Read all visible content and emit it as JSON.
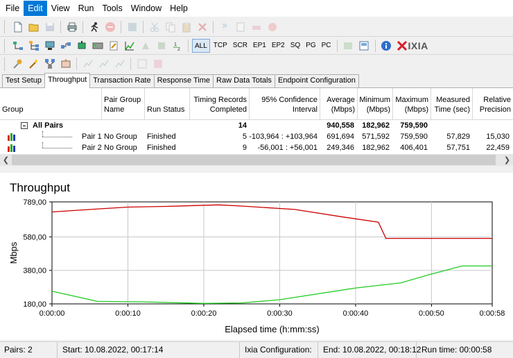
{
  "menu": {
    "items": [
      {
        "label": "File"
      },
      {
        "label": "Edit"
      },
      {
        "label": "View"
      },
      {
        "label": "Run"
      },
      {
        "label": "Tools"
      },
      {
        "label": "Window"
      },
      {
        "label": "Help"
      }
    ]
  },
  "toolbar": {
    "protocols": [
      "ALL",
      "TCP",
      "SCR",
      "EP1",
      "EP2",
      "SQ",
      "PG",
      "PC"
    ],
    "logo_text": "IXIA"
  },
  "tabs": [
    {
      "label": "Test Setup"
    },
    {
      "label": "Throughput"
    },
    {
      "label": "Transaction Rate"
    },
    {
      "label": "Response Time"
    },
    {
      "label": "Raw Data Totals"
    },
    {
      "label": "Endpoint Configuration"
    }
  ],
  "table": {
    "headers": {
      "group": "Group",
      "pair_group_1": "Pair Group",
      "pair_group_2": "Name",
      "run_status": "Run Status",
      "timing_1": "Timing Records",
      "timing_2": "Completed",
      "conf_1": "95% Confidence",
      "conf_2": "Interval",
      "avg_1": "Average",
      "avg_2": "(Mbps)",
      "min_1": "Minimum",
      "min_2": "(Mbps)",
      "max_1": "Maximum",
      "max_2": "(Mbps)",
      "meas_1": "Measured",
      "meas_2": "Time (sec)",
      "rel_1": "Relative",
      "rel_2": "Precision"
    },
    "all_pairs": {
      "label": "All Pairs",
      "records": "14",
      "average": "940,558",
      "minimum": "182,962",
      "maximum": "759,590"
    },
    "pairs": [
      {
        "label": "Pair 1",
        "pair_group": "No Group",
        "status": "Finished",
        "records": "5",
        "confidence": "-103,964 : +103,964",
        "average": "691,694",
        "minimum": "571,592",
        "maximum": "759,590",
        "measured": "57,829",
        "relative": "15,030"
      },
      {
        "label": "Pair 2",
        "pair_group": "No Group",
        "status": "Finished",
        "records": "9",
        "confidence": "-56,001 : +56,001",
        "average": "249,346",
        "minimum": "182,962",
        "maximum": "406,401",
        "measured": "57,751",
        "relative": "22,459"
      }
    ]
  },
  "chart_data": {
    "type": "line",
    "title": "Throughput",
    "xlabel": "Elapsed time (h:mm:ss)",
    "ylabel": "Mbps",
    "x_ticks": [
      "0:00:00",
      "0:00:10",
      "0:00:20",
      "0:00:30",
      "0:00:40",
      "0:00:50",
      "0:00:58"
    ],
    "y_ticks": [
      "789,00",
      "580,00",
      "380,00",
      "180,00"
    ],
    "xlim": [
      "0:00:00",
      "0:00:58"
    ],
    "ylim": [
      180,
      789
    ],
    "grid": true,
    "series": [
      {
        "color": "#cc0000",
        "points": [
          [
            "0:00:00",
            729
          ],
          [
            "0:00:05",
            744
          ],
          [
            "0:00:10",
            758
          ],
          [
            "0:00:15",
            762
          ],
          [
            "0:00:22",
            771
          ],
          [
            "0:00:25",
            764
          ],
          [
            "0:00:32",
            744
          ],
          [
            "0:00:38",
            701
          ],
          [
            "0:00:43",
            668
          ],
          [
            "0:00:44",
            571
          ],
          [
            "0:00:50",
            571
          ],
          [
            "0:00:58",
            571
          ]
        ]
      },
      {
        "color": "#22cc22",
        "points": [
          [
            "0:00:00",
            256
          ],
          [
            "0:00:06",
            195
          ],
          [
            "0:00:12",
            192
          ],
          [
            "0:00:20",
            183
          ],
          [
            "0:00:25",
            186
          ],
          [
            "0:00:30",
            205
          ],
          [
            "0:00:40",
            275
          ],
          [
            "0:00:46",
            306
          ],
          [
            "0:00:50",
            358
          ],
          [
            "0:00:54",
            406
          ],
          [
            "0:00:58",
            406
          ]
        ]
      }
    ]
  },
  "status": {
    "pairs": "Pairs: 2",
    "start": "Start: 10.08.2022, 00:17:14",
    "ixia_config": "Ixia Configuration:",
    "end": "End: 10.08.2022, 00:18:12",
    "run_time": "Run time: 00:00:58"
  }
}
